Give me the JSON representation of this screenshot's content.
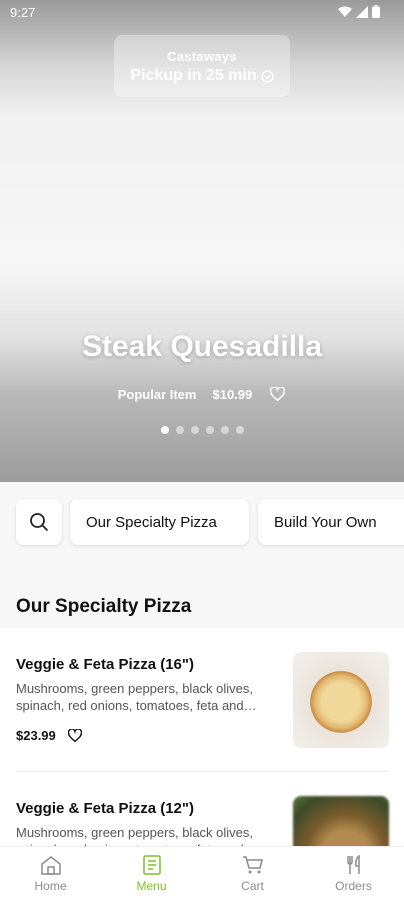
{
  "status_bar": {
    "time": "9:27"
  },
  "pickup": {
    "store": "Castaways",
    "label": "Pickup in 25 min"
  },
  "hero": {
    "title": "Steak Quesadilla",
    "tag": "Popular Item",
    "price": "$10.99",
    "slide_count": 6,
    "active_slide": 1
  },
  "categories": {
    "chip1": "Our Specialty Pizza",
    "chip2": "Build Your Own"
  },
  "section": {
    "title": "Our Specialty Pizza"
  },
  "items": [
    {
      "name": "Veggie & Feta Pizza (16\")",
      "description": "Mushrooms, green peppers, black olives, spinach, red onions, tomatoes, feta and…",
      "price": "$23.99"
    },
    {
      "name": "Veggie & Feta Pizza (12\")",
      "description": "Mushrooms, green peppers, black olives, spinach, red onions, tomatoes, feta and…"
    }
  ],
  "nav": {
    "home": "Home",
    "menu": "Menu",
    "cart": "Cart",
    "orders": "Orders"
  },
  "colors": {
    "accent": "#7cbf2a"
  }
}
